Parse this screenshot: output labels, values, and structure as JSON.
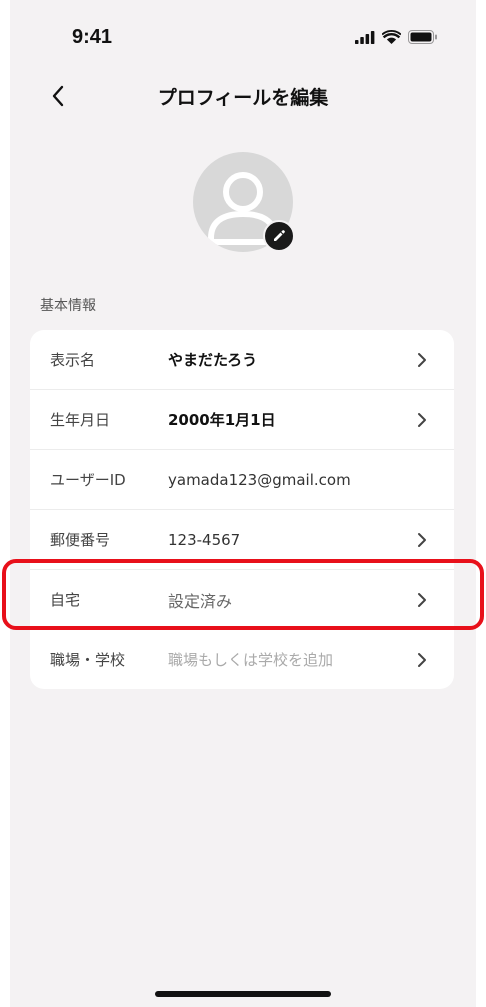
{
  "status_bar": {
    "time": "9:41"
  },
  "nav": {
    "title": "プロフィールを編集"
  },
  "section": {
    "label": "基本情報"
  },
  "rows": [
    {
      "label": "表示名",
      "value": "やまだたろう"
    },
    {
      "label": "生年月日",
      "value": "2000年1月1日"
    },
    {
      "label": "ユーザーID",
      "value": "yamada123@gmail.com"
    },
    {
      "label": "郵便番号",
      "value": "123-4567"
    },
    {
      "label": "自宅",
      "value": "設定済み"
    },
    {
      "label": "職場・学校",
      "value": "職場もしくは学校を追加"
    }
  ],
  "colors": {
    "background": "#f4f2f3",
    "card": "#ffffff",
    "highlight": "#e8101a",
    "edit_button": "#1a1a1a"
  },
  "icons": {
    "back": "chevron-left-icon",
    "edit": "pencil-icon",
    "row_arrow": "chevron-right-icon",
    "avatar": "person-placeholder-icon"
  }
}
